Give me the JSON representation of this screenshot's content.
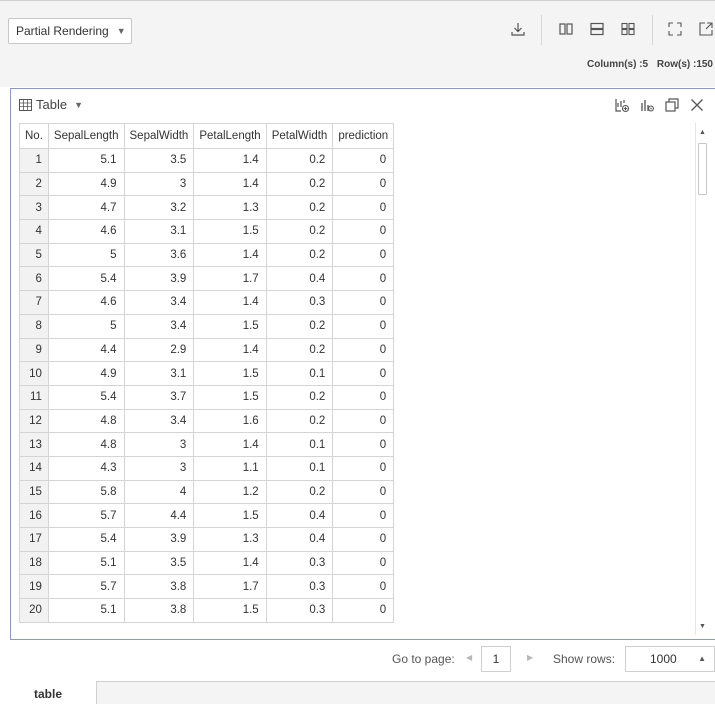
{
  "toolbar": {
    "render_mode": "Partial Rendering",
    "icons": [
      "download-icon",
      "column-layout-icon",
      "row-layout-icon",
      "grid-layout-icon",
      "fullscreen-icon",
      "external-link-icon"
    ],
    "columns_count": "Column(s) :5",
    "rows_count": "Row(s) :150"
  },
  "panel": {
    "title": "Table",
    "icons": [
      "add-chart-icon",
      "chart-settings-icon",
      "copy-window-icon",
      "close-icon"
    ],
    "columns": [
      "No.",
      "SepalLength",
      "SepalWidth",
      "PetalLength",
      "PetalWidth",
      "prediction"
    ],
    "rows": [
      [
        "1",
        "5.1",
        "3.5",
        "1.4",
        "0.2",
        "0"
      ],
      [
        "2",
        "4.9",
        "3",
        "1.4",
        "0.2",
        "0"
      ],
      [
        "3",
        "4.7",
        "3.2",
        "1.3",
        "0.2",
        "0"
      ],
      [
        "4",
        "4.6",
        "3.1",
        "1.5",
        "0.2",
        "0"
      ],
      [
        "5",
        "5",
        "3.6",
        "1.4",
        "0.2",
        "0"
      ],
      [
        "6",
        "5.4",
        "3.9",
        "1.7",
        "0.4",
        "0"
      ],
      [
        "7",
        "4.6",
        "3.4",
        "1.4",
        "0.3",
        "0"
      ],
      [
        "8",
        "5",
        "3.4",
        "1.5",
        "0.2",
        "0"
      ],
      [
        "9",
        "4.4",
        "2.9",
        "1.4",
        "0.2",
        "0"
      ],
      [
        "10",
        "4.9",
        "3.1",
        "1.5",
        "0.1",
        "0"
      ],
      [
        "11",
        "5.4",
        "3.7",
        "1.5",
        "0.2",
        "0"
      ],
      [
        "12",
        "4.8",
        "3.4",
        "1.6",
        "0.2",
        "0"
      ],
      [
        "13",
        "4.8",
        "3",
        "1.4",
        "0.1",
        "0"
      ],
      [
        "14",
        "4.3",
        "3",
        "1.1",
        "0.1",
        "0"
      ],
      [
        "15",
        "5.8",
        "4",
        "1.2",
        "0.2",
        "0"
      ],
      [
        "16",
        "5.7",
        "4.4",
        "1.5",
        "0.4",
        "0"
      ],
      [
        "17",
        "5.4",
        "3.9",
        "1.3",
        "0.4",
        "0"
      ],
      [
        "18",
        "5.1",
        "3.5",
        "1.4",
        "0.3",
        "0"
      ],
      [
        "19",
        "5.7",
        "3.8",
        "1.7",
        "0.3",
        "0"
      ],
      [
        "20",
        "5.1",
        "3.8",
        "1.5",
        "0.3",
        "0"
      ]
    ]
  },
  "pager": {
    "goto_label": "Go to page:",
    "page_value": "1",
    "show_rows_label": "Show rows:",
    "rows_value": "1000"
  },
  "tabs": {
    "active": "table"
  },
  "colors": {
    "panel_border": "#8a9ac8",
    "index_bg": "#f2f2f2",
    "toolbar_bg": "#f4f4f4"
  }
}
